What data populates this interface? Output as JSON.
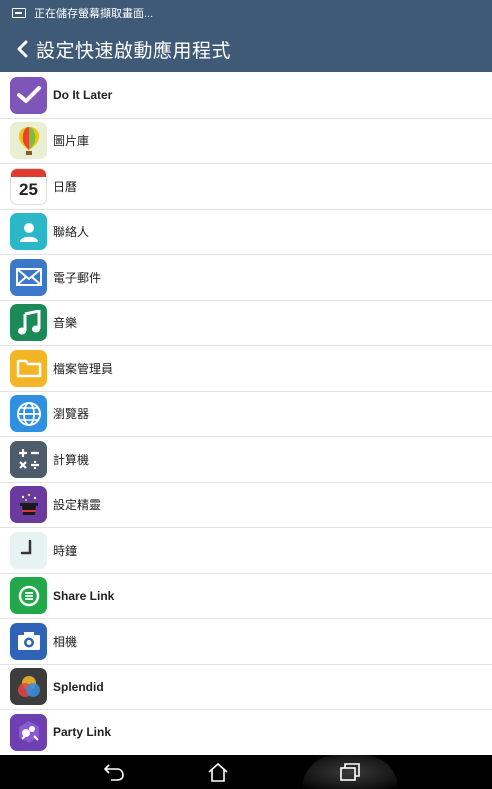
{
  "status": {
    "text": "正在儲存螢幕擷取畫面..."
  },
  "appbar": {
    "title": "設定快速啟動應用程式"
  },
  "colors": {
    "appbar": "#3f5a76",
    "navbar": "#000000"
  },
  "apps": [
    {
      "label": "Do It Later",
      "icon": "checkmark-icon",
      "color": "#7e55b8"
    },
    {
      "label": "圖片庫",
      "icon": "balloon-icon",
      "color": "#e9efd2"
    },
    {
      "label": "日曆",
      "icon": "calendar-icon",
      "day": "25"
    },
    {
      "label": "聯絡人",
      "icon": "contact-icon",
      "color": "#2bb7c8"
    },
    {
      "label": "電子郵件",
      "icon": "envelope-icon",
      "color": "#3b78c9"
    },
    {
      "label": "音樂",
      "icon": "music-note-icon",
      "color": "#1c8a57"
    },
    {
      "label": "檔案管理員",
      "icon": "folder-icon",
      "color": "#f3b526"
    },
    {
      "label": "瀏覽器",
      "icon": "globe-icon",
      "color": "#2f8fe0"
    },
    {
      "label": "計算機",
      "icon": "calculator-icon",
      "color": "#4d5b6b"
    },
    {
      "label": "設定精靈",
      "icon": "magic-hat-icon",
      "color": "#6a3a9e"
    },
    {
      "label": "時鐘",
      "icon": "clock-icon",
      "color": "#e7f2f2"
    },
    {
      "label": "Share Link",
      "icon": "share-link-icon",
      "color": "#22a84a"
    },
    {
      "label": "相機",
      "icon": "camera-icon",
      "color": "#2e63b5"
    },
    {
      "label": "Splendid",
      "icon": "splendid-icon",
      "color": "#3d3d3d"
    },
    {
      "label": "Party Link",
      "icon": "party-link-icon",
      "color": "#6d3fb0"
    }
  ],
  "navbar": [
    "back-icon",
    "home-icon",
    "recent-apps-icon"
  ]
}
